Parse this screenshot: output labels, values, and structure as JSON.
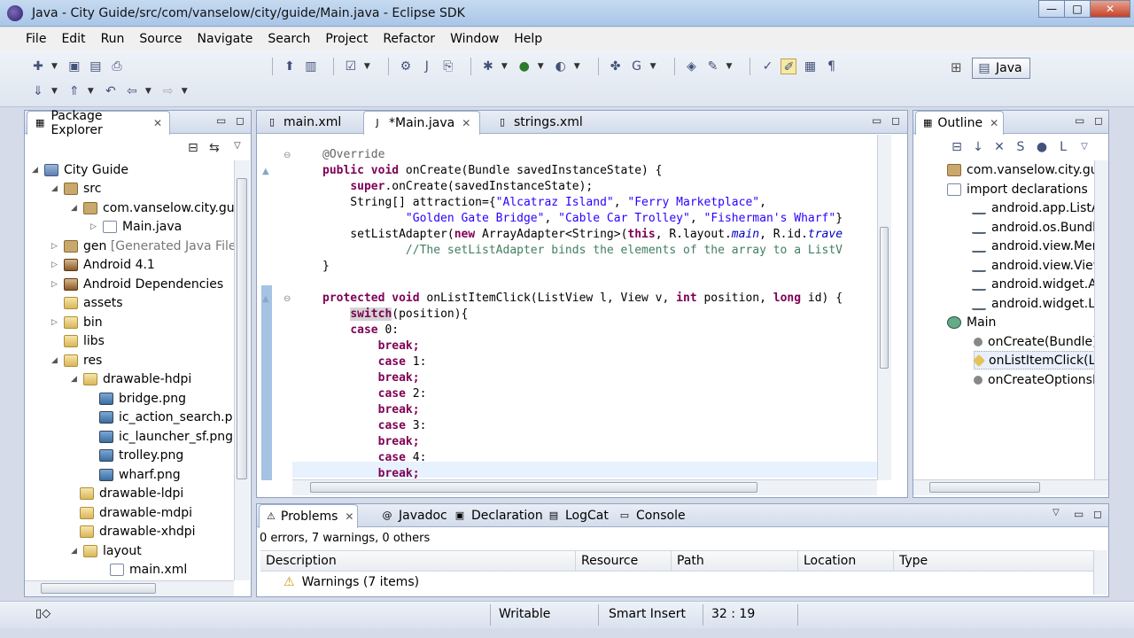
{
  "window": {
    "title": "Java - City Guide/src/com/vanselow/city/guide/Main.java - Eclipse SDK",
    "minimize": "—",
    "maximize": "□",
    "close": "✕"
  },
  "menu": [
    "File",
    "Edit",
    "Run",
    "Source",
    "Navigate",
    "Search",
    "Project",
    "Refactor",
    "Window",
    "Help"
  ],
  "toolbar": {
    "perspective_label": "Java"
  },
  "package_explorer": {
    "title": "Package Explorer",
    "items": [
      {
        "label": "City Guide",
        "extra": ""
      },
      {
        "label": "src",
        "extra": ""
      },
      {
        "label": "com.vanselow.city.gu",
        "extra": ""
      },
      {
        "label": "Main.java",
        "extra": ""
      },
      {
        "label": "gen",
        "extra": "[Generated Java Files"
      },
      {
        "label": "Android 4.1",
        "extra": ""
      },
      {
        "label": "Android Dependencies",
        "extra": ""
      },
      {
        "label": "assets",
        "extra": ""
      },
      {
        "label": "bin",
        "extra": ""
      },
      {
        "label": "libs",
        "extra": ""
      },
      {
        "label": "res",
        "extra": ""
      },
      {
        "label": "drawable-hdpi",
        "extra": ""
      },
      {
        "label": "bridge.png",
        "extra": ""
      },
      {
        "label": "ic_action_search.p",
        "extra": ""
      },
      {
        "label": "ic_launcher_sf.png",
        "extra": ""
      },
      {
        "label": "trolley.png",
        "extra": ""
      },
      {
        "label": "wharf.png",
        "extra": ""
      },
      {
        "label": "drawable-ldpi",
        "extra": ""
      },
      {
        "label": "drawable-mdpi",
        "extra": ""
      },
      {
        "label": "drawable-xhdpi",
        "extra": ""
      },
      {
        "label": "layout",
        "extra": ""
      },
      {
        "label": "main.xml",
        "extra": ""
      }
    ]
  },
  "editor": {
    "tabs": [
      "main.xml",
      "*Main.java",
      "strings.xml"
    ],
    "active_tab": "*Main.java",
    "code": [
      "@Override",
      "public void onCreate(Bundle savedInstanceState) {",
      "    super.onCreate(savedInstanceState);",
      "    String[] attraction={\"Alcatraz Island\", \"Ferry Marketplace\",",
      "            \"Golden Gate Bridge\", \"Cable Car Trolley\", \"Fisherman's Wharf\"}",
      "    setListAdapter(new ArrayAdapter<String>(this, R.layout.main, R.id.trave",
      "            //The setListAdapter binds the elements of the array to a ListV",
      "}",
      "",
      "protected void onListItemClick(ListView l, View v, int position, long id) {",
      "    switch(position){",
      "    case 0:",
      "        break;",
      "        case 1:",
      "        break;",
      "        case 2:",
      "        break;",
      "        case 3:",
      "        break;",
      "        case 4:",
      "        break;"
    ]
  },
  "outline": {
    "title": "Outline",
    "items": [
      "com.vanselow.city.guide",
      "import declarations",
      "android.app.ListAct",
      "android.os.Bundle",
      "android.view.Menu",
      "android.view.View",
      "android.widget.Arra",
      "android.widget.List",
      "Main",
      "onCreate(Bundle) :",
      "onListItemClick(List",
      "onCreateOptionsM"
    ]
  },
  "problems_view": {
    "tabs": [
      "Problems",
      "Javadoc",
      "Declaration",
      "LogCat",
      "Console"
    ],
    "summary": "0 errors, 7 warnings, 0 others",
    "columns": [
      "Description",
      "Resource",
      "Path",
      "Location",
      "Type"
    ],
    "rows": [
      "Warnings (7 items)"
    ]
  },
  "status": {
    "writable": "Writable",
    "insert_mode": "Smart Insert",
    "position": "32 : 19"
  }
}
